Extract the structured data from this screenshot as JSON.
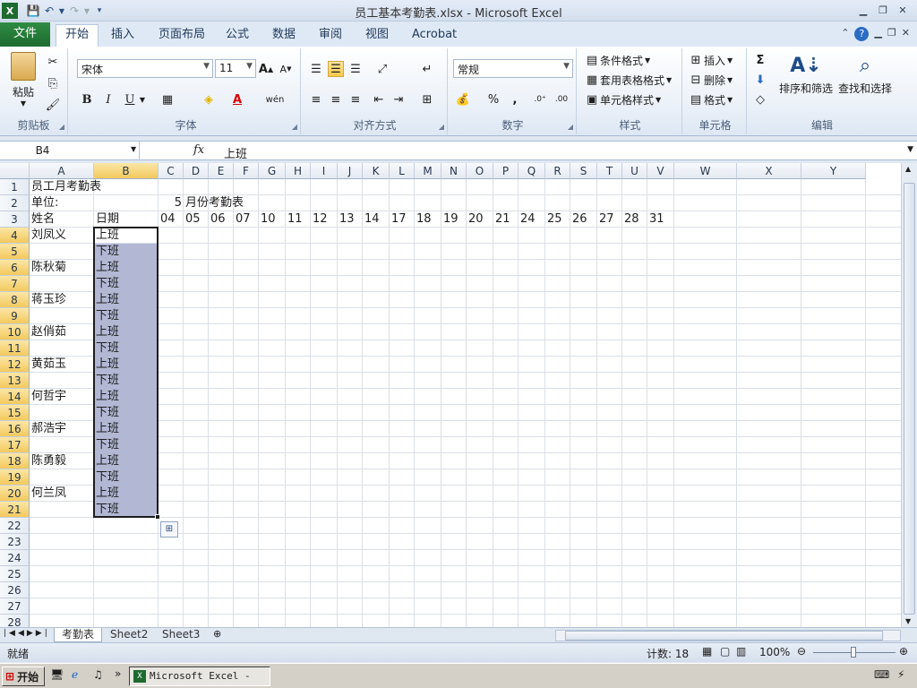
{
  "window": {
    "title": "员工基本考勤表.xlsx - Microsoft Excel"
  },
  "tabs": [
    "文件",
    "开始",
    "插入",
    "页面布局",
    "公式",
    "数据",
    "审阅",
    "视图",
    "Acrobat"
  ],
  "ribbon": {
    "clipboard": {
      "label": "剪贴板",
      "paste": "粘贴"
    },
    "font": {
      "label": "字体",
      "name": "宋体",
      "size": "11",
      "bold": "B",
      "italic": "I",
      "underline": "U"
    },
    "alignment": {
      "label": "对齐方式"
    },
    "number": {
      "label": "数字",
      "format": "常规",
      "percent": "%",
      "comma": ","
    },
    "styles": {
      "label": "样式",
      "conditional": "条件格式",
      "table": "套用表格格式",
      "cell": "单元格样式"
    },
    "cells": {
      "label": "单元格",
      "insert": "插入",
      "delete": "删除",
      "format": "格式"
    },
    "editing": {
      "label": "编辑",
      "sort": "排序和筛选",
      "find": "查找和选择",
      "sigma": "Σ"
    }
  },
  "formula_bar": {
    "name_box": "B4",
    "fx": "fx",
    "value": "上班"
  },
  "columns": [
    "A",
    "B",
    "C",
    "D",
    "E",
    "F",
    "G",
    "H",
    "I",
    "J",
    "K",
    "L",
    "M",
    "N",
    "O",
    "P",
    "Q",
    "R",
    "S",
    "T",
    "U",
    "V",
    "W",
    "X",
    "Y"
  ],
  "rows": [
    "1",
    "2",
    "3",
    "4",
    "5",
    "6",
    "7",
    "8",
    "9",
    "10",
    "11",
    "12",
    "13",
    "14",
    "15",
    "16",
    "17",
    "18",
    "19",
    "20",
    "21",
    "22",
    "23",
    "24",
    "25",
    "26",
    "27",
    "28"
  ],
  "cells": {
    "a1": "员工月考勤表",
    "a2": "单位:",
    "c2": "5",
    "d2": "月份考勤表",
    "a3": "姓名",
    "b3": "日期",
    "days": [
      "04",
      "05",
      "06",
      "07",
      "10",
      "11",
      "12",
      "13",
      "14",
      "17",
      "18",
      "19",
      "20",
      "21",
      "24",
      "25",
      "26",
      "27",
      "28",
      "31"
    ],
    "names": [
      "刘凤义",
      "陈秋菊",
      "蒋玉珍",
      "赵俏茹",
      "黄茹玉",
      "何哲宇",
      "郝浩宇",
      "陈勇毅",
      "何兰凤"
    ],
    "shift_on": "上班",
    "shift_off": "下班"
  },
  "sheets": [
    "考勤表",
    "Sheet2",
    "Sheet3"
  ],
  "status": {
    "ready": "就绪",
    "count": "计数: 18",
    "zoom": "100%"
  },
  "taskbar": {
    "start": "开始",
    "item": "Microsoft Excel - ..."
  },
  "colors": {
    "accent": "#1d6b2f",
    "selection": "#b2b8d4",
    "header_highlight": "#f3c95d"
  }
}
